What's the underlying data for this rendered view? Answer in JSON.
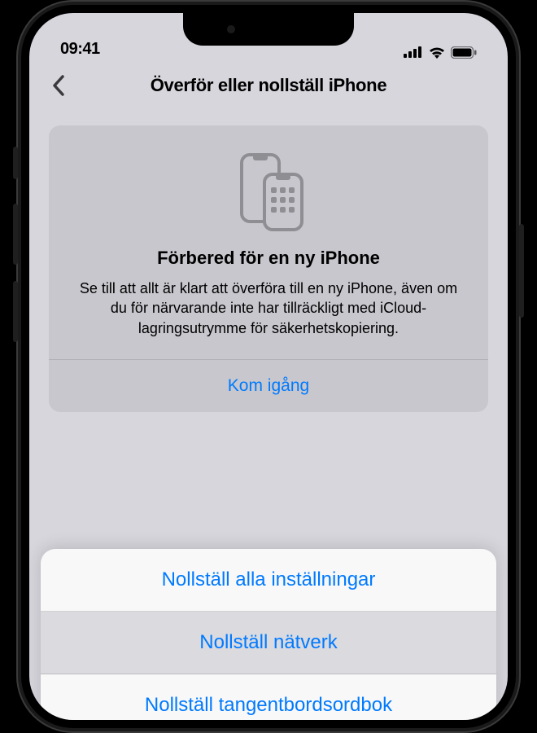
{
  "statusbar": {
    "time": "09:41"
  },
  "nav": {
    "title": "Överför eller nollställ iPhone"
  },
  "card": {
    "title": "Förbered för en ny iPhone",
    "description": "Se till att allt är klart att överföra till en ny iPhone, även om du för närvarande inte har tillräckligt med iCloud-lagringsutrymme för säkerhetskopiering.",
    "action": "Kom igång"
  },
  "sheet": {
    "items": [
      {
        "label": "Nollställ alla inställningar"
      },
      {
        "label": "Nollställ nätverk"
      },
      {
        "label": "Nollställ tangentbordsordbok"
      }
    ]
  }
}
